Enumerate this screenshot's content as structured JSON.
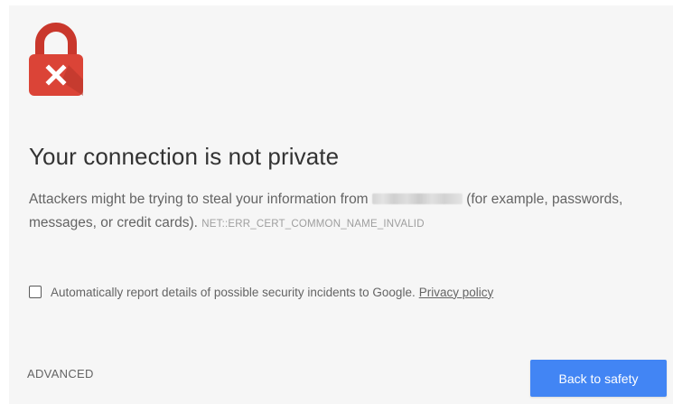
{
  "colors": {
    "background": "#f6f6f6",
    "lock_red": "#db4437",
    "lock_shackle": "#c9372c",
    "primary_button": "#4285f4",
    "title_text": "#333333",
    "body_text": "#646464",
    "error_code_text": "#9e9e9e"
  },
  "icon": {
    "name": "lock-error-icon"
  },
  "heading": {
    "title": "Your connection is not private"
  },
  "message": {
    "before_host": "Attackers might be trying to steal your information from ",
    "after_host": " (for example, passwords, messages, or credit cards).",
    "error_code": "NET::ERR_CERT_COMMON_NAME_INVALID"
  },
  "report": {
    "checked": false,
    "label": "Automatically report details of possible security incidents to Google.",
    "privacy_link": "Privacy policy"
  },
  "actions": {
    "advanced_label": "ADVANCED",
    "back_label": "Back to safety"
  }
}
